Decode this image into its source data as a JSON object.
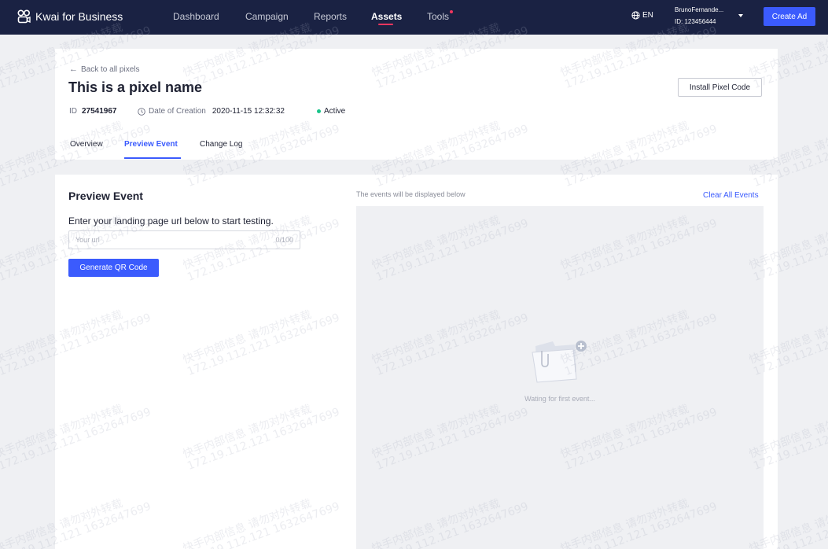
{
  "app": {
    "brand": "Kwai for Business",
    "nav": [
      "Dashboard",
      "Campaign",
      "Reports",
      "Assets",
      "Tools"
    ],
    "active_nav": "Assets",
    "language": "EN",
    "user_name": "BrunoFernande...",
    "user_id": "ID: 123456444",
    "create_ad_label": "Create Ad"
  },
  "header": {
    "back_label": "Back to all pixels",
    "pixel_name": "This is a pixel name",
    "install_label": "Install Pixel Code",
    "id_label": "ID",
    "id_value": "27541967",
    "date_label": "Date of Creation",
    "date_value": "2020-11-15 12:32:32",
    "status": "Active",
    "tabs": [
      "Overview",
      "Preview Event",
      "Change Log"
    ],
    "active_tab": "Preview Event"
  },
  "preview": {
    "title": "Preview Event",
    "instructions": "Enter your landing page url below to start testing.",
    "url_placeholder": "Your url",
    "url_value": "",
    "url_counter": "0/100",
    "qr_button": "Generate QR Code",
    "events_caption": "The events will be displayed below",
    "clear_all": "Clear All Events",
    "waiting": "Wating for first event..."
  },
  "watermark": {
    "line1": "快手内部信息 请勿对外转载",
    "line2": "172.19.112.121 1632647699"
  },
  "colors": {
    "topbar": "#1a2243",
    "accent": "#3b5bfd",
    "active_indicator": "#f2365f",
    "status_active": "#19c48a",
    "page_bg": "#eff0f3"
  }
}
